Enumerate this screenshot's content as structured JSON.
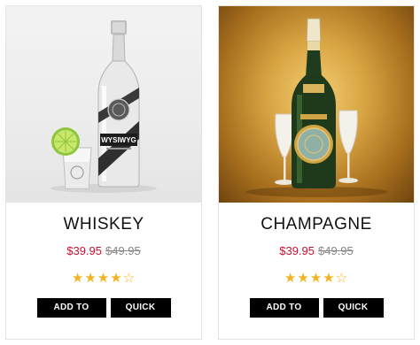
{
  "products": [
    {
      "name": "WHISKEY",
      "sale_price": "$39.95",
      "old_price": "$49.95",
      "rating": 4,
      "rating_max": 5,
      "bottle_label": "WYSIWYG",
      "add_to_cart_label": "ADD TO CART",
      "quick_view_label": "QUICK VIEW"
    },
    {
      "name": "CHAMPAGNE",
      "sale_price": "$39.95",
      "old_price": "$49.95",
      "rating": 4,
      "rating_max": 5,
      "add_to_cart_label": "ADD TO CART",
      "quick_view_label": "QUICK VIEW"
    }
  ],
  "colors": {
    "sale_price": "#c8102e",
    "old_price": "#888888",
    "star": "#f2b320",
    "button_bg": "#000000",
    "button_text": "#ffffff"
  }
}
